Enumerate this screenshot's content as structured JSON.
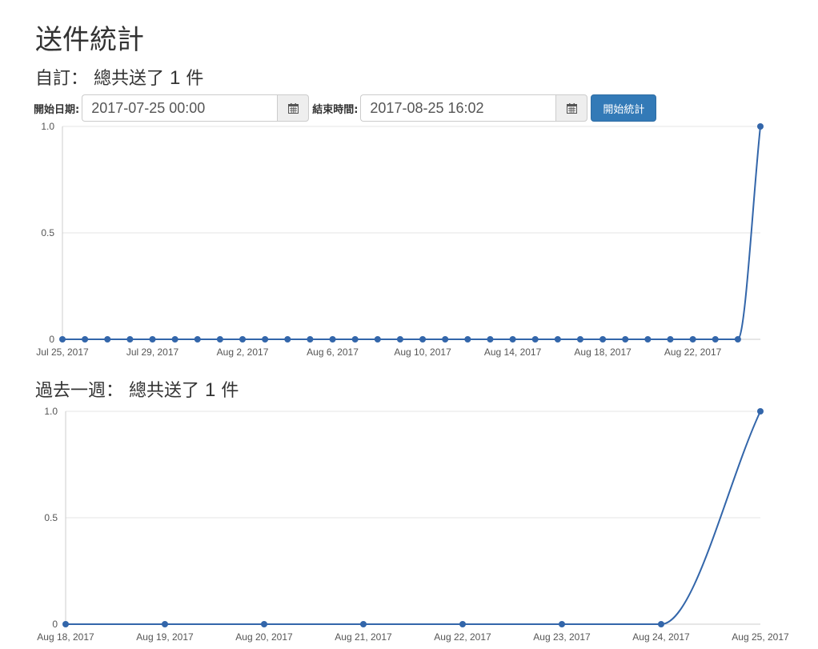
{
  "page": {
    "title": "送件統計"
  },
  "custom": {
    "heading_prefix": "自訂：",
    "heading_text": "總共送了",
    "count": "1",
    "heading_unit": "件"
  },
  "filters": {
    "start_label": "開始日期:",
    "start_value": "2017-07-25 00:00",
    "end_label": "結束時間:",
    "end_value": "2017-08-25 16:02",
    "button_label": "開始統計"
  },
  "week": {
    "heading_prefix": "過去一週：",
    "heading_text": "總共送了",
    "count": "1",
    "heading_unit": "件"
  },
  "colors": {
    "series": "#3366aa",
    "button": "#337ab7"
  },
  "chart_data": [
    {
      "type": "line",
      "x": [
        "2017-07-25",
        "2017-07-26",
        "2017-07-27",
        "2017-07-28",
        "2017-07-29",
        "2017-07-30",
        "2017-07-31",
        "2017-08-01",
        "2017-08-02",
        "2017-08-03",
        "2017-08-04",
        "2017-08-05",
        "2017-08-06",
        "2017-08-07",
        "2017-08-08",
        "2017-08-09",
        "2017-08-10",
        "2017-08-11",
        "2017-08-12",
        "2017-08-13",
        "2017-08-14",
        "2017-08-15",
        "2017-08-16",
        "2017-08-17",
        "2017-08-18",
        "2017-08-19",
        "2017-08-20",
        "2017-08-21",
        "2017-08-22",
        "2017-08-23",
        "2017-08-24",
        "2017-08-25"
      ],
      "series": [
        {
          "values": [
            0,
            0,
            0,
            0,
            0,
            0,
            0,
            0,
            0,
            0,
            0,
            0,
            0,
            0,
            0,
            0,
            0,
            0,
            0,
            0,
            0,
            0,
            0,
            0,
            0,
            0,
            0,
            0,
            0,
            0,
            0,
            1
          ]
        }
      ],
      "x_ticks": [
        "Jul 25, 2017",
        "Jul 29, 2017",
        "Aug 2, 2017",
        "Aug 6, 2017",
        "Aug 10, 2017",
        "Aug 14, 2017",
        "Aug 18, 2017",
        "Aug 22, 2017"
      ],
      "x_tick_index": [
        0,
        4,
        8,
        12,
        16,
        20,
        24,
        28
      ],
      "y_ticks": [
        "0",
        "0.5",
        "1.0"
      ],
      "ylim": [
        0,
        1
      ],
      "grid": true
    },
    {
      "type": "line",
      "x": [
        "2017-08-18",
        "2017-08-19",
        "2017-08-20",
        "2017-08-21",
        "2017-08-22",
        "2017-08-23",
        "2017-08-24",
        "2017-08-25"
      ],
      "series": [
        {
          "values": [
            0,
            0,
            0,
            0,
            0,
            0,
            0,
            1
          ]
        }
      ],
      "x_ticks": [
        "Aug 18, 2017",
        "Aug 19, 2017",
        "Aug 20, 2017",
        "Aug 21, 2017",
        "Aug 22, 2017",
        "Aug 23, 2017",
        "Aug 24, 2017",
        "Aug 25, 2017"
      ],
      "x_tick_index": [
        0,
        1,
        2,
        3,
        4,
        5,
        6,
        7
      ],
      "y_ticks": [
        "0",
        "0.5",
        "1.0"
      ],
      "ylim": [
        0,
        1
      ],
      "grid": true
    }
  ]
}
